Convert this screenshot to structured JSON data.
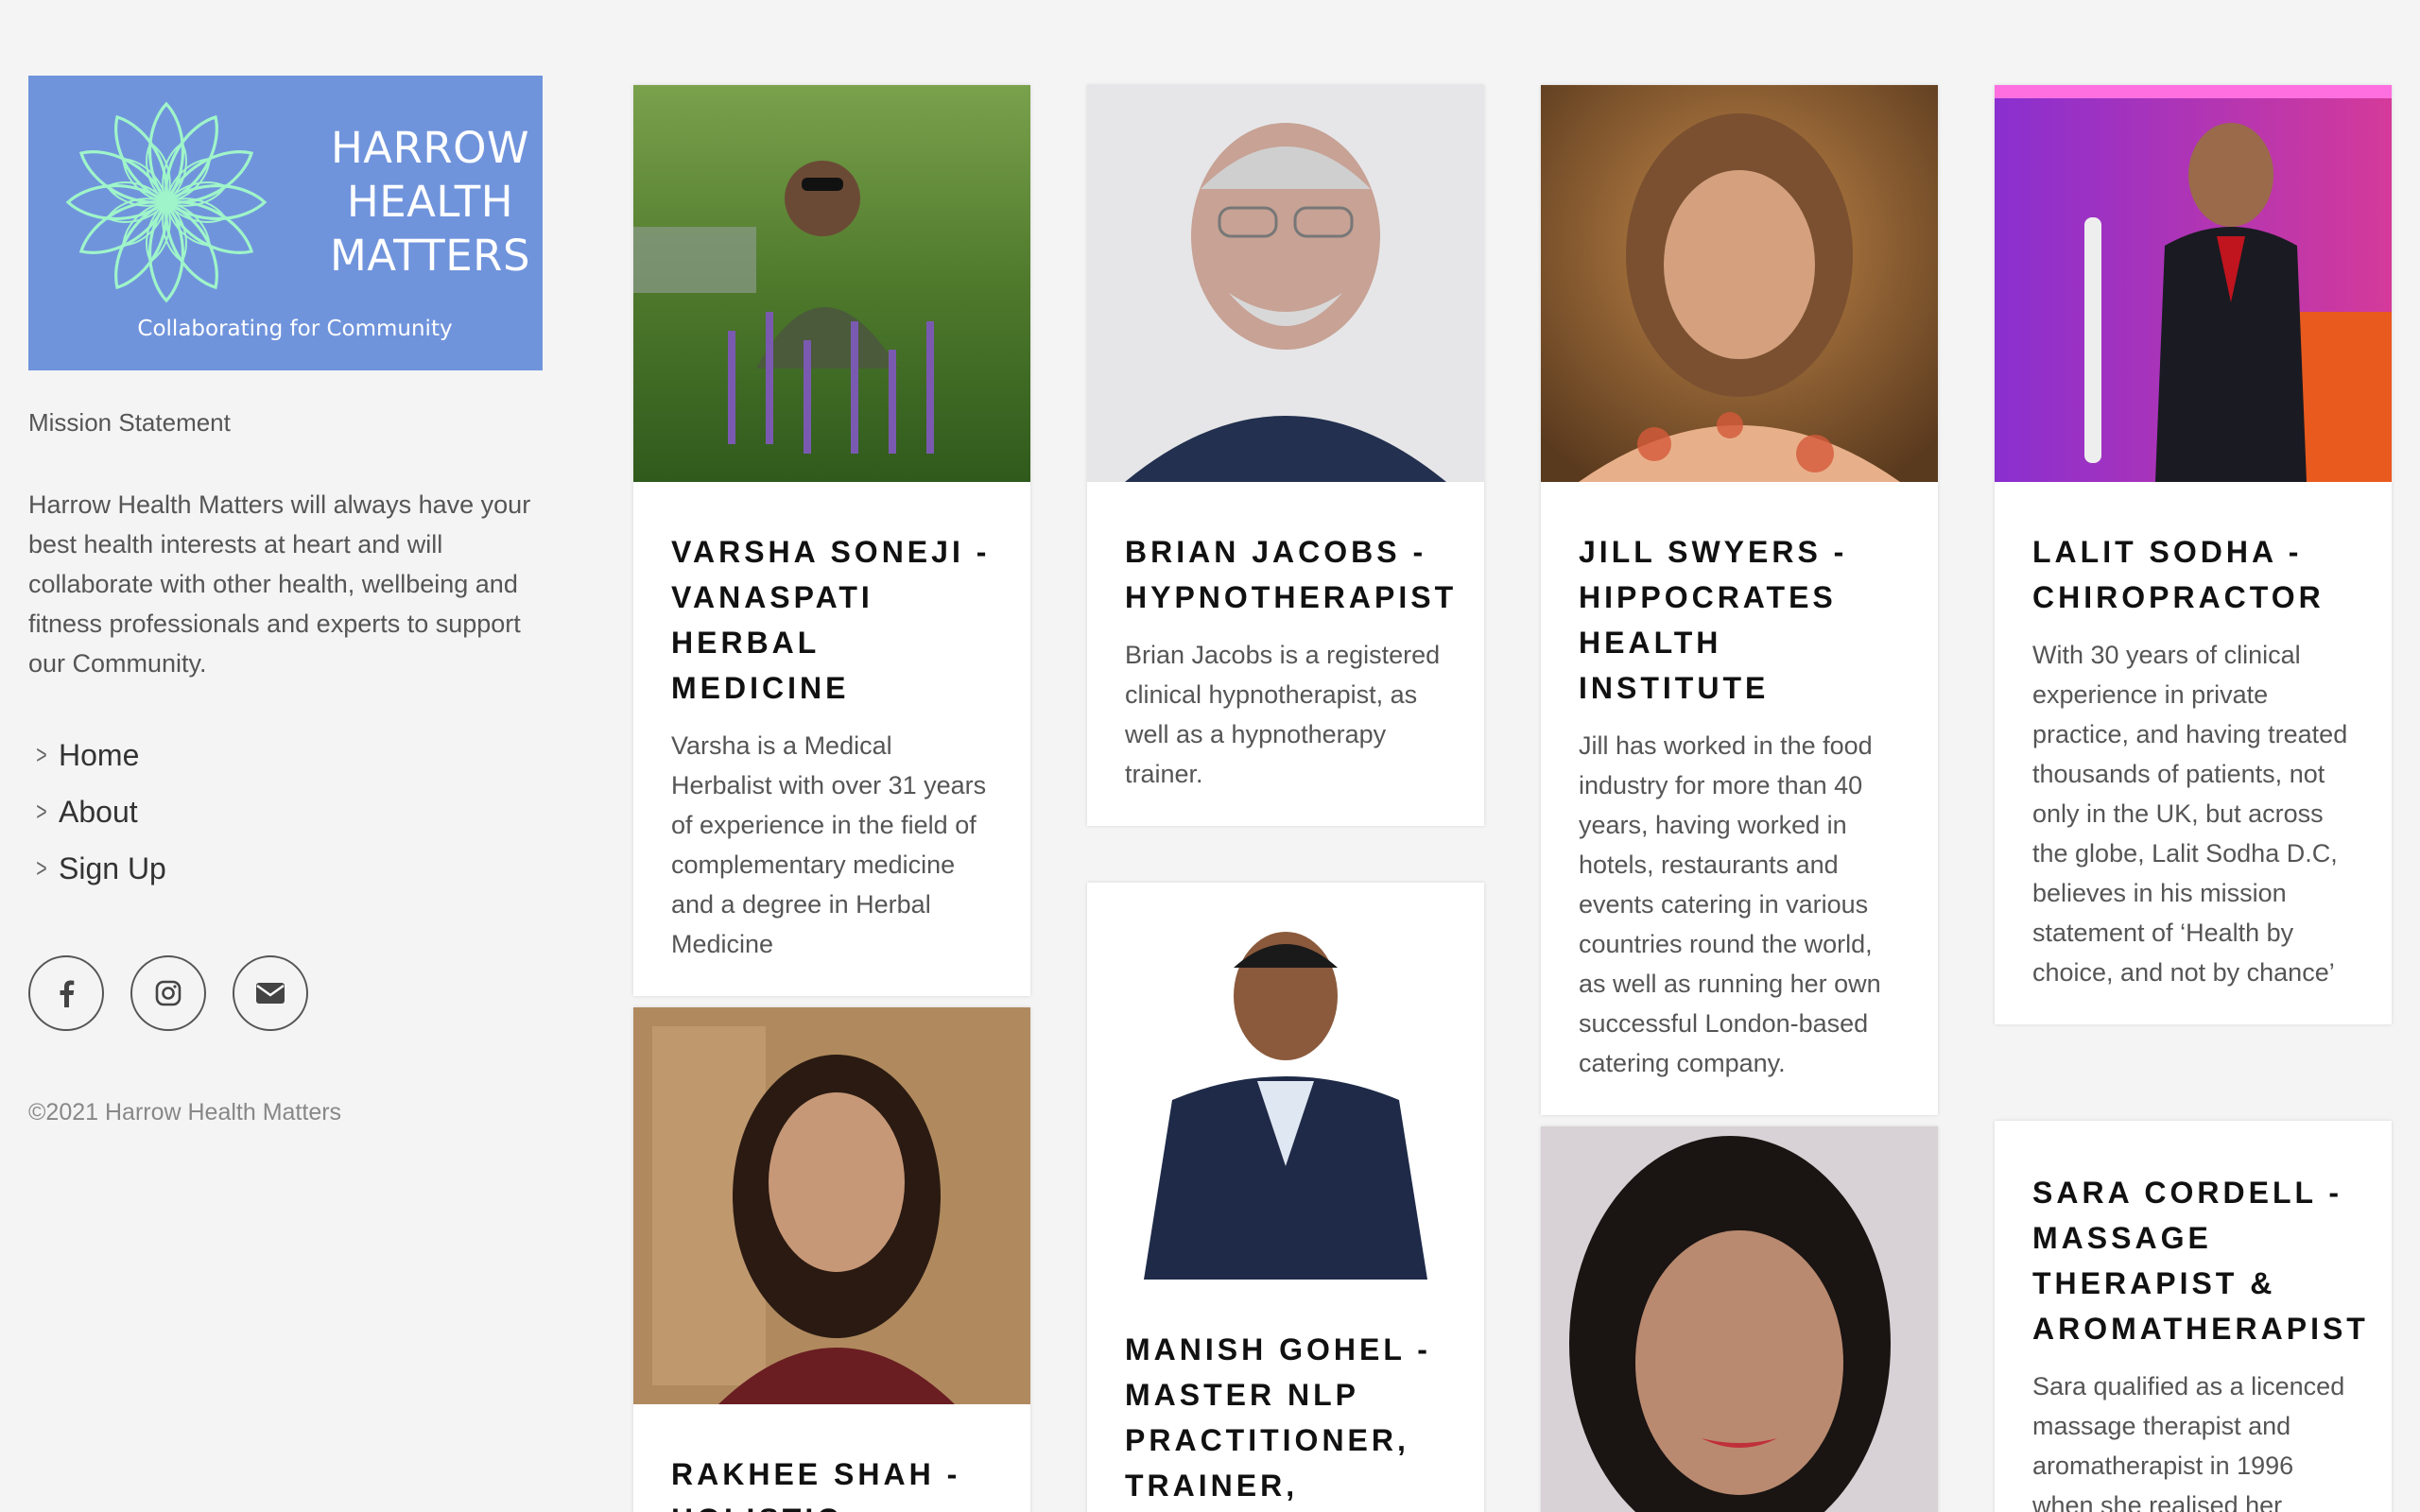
{
  "brand": {
    "line1": "HARROW",
    "line2": "HEALTH",
    "line3": "MATTERS",
    "tagline": "Collaborating for Community",
    "logo_bg": "#7094dc",
    "flower_color": "#9ff5c9"
  },
  "mission": {
    "title": "Mission Statement",
    "text": "Harrow Health Matters will always have your best health interests at heart and will collaborate with other health, wellbeing and fitness professionals and experts to support our Community."
  },
  "nav": [
    {
      "label": "Home"
    },
    {
      "label": "About"
    },
    {
      "label": "Sign Up"
    }
  ],
  "social": [
    {
      "icon": "facebook-icon"
    },
    {
      "icon": "instagram-icon"
    },
    {
      "icon": "envelope-icon"
    }
  ],
  "footer": {
    "copyright": "©2021 Harrow Health Matters"
  },
  "cards": [
    {
      "title": "VARSHA SONEJI - VANASPATI HERBAL MEDICINE",
      "text": "Varsha is a Medical Herbalist with over 31 years of experience in the field of complementary medicine and a degree in Herbal Medicine"
    },
    {
      "title": "BRIAN JACOBS - HYPNOTHERAPIST",
      "text": "Brian Jacobs is a registered clinical hypnotherapist, as well as a hypnotherapy trainer."
    },
    {
      "title": "JILL SWYERS - HIPPOCRATES HEALTH INSTITUTE",
      "text": "Jill has worked in the food industry for more than 40 years, having worked in hotels, restaurants and events catering in various countries round the world, as well as running her own successful London-based catering company."
    },
    {
      "title": "LALIT SODHA - CHIROPRACTOR",
      "text": "With 30 years of clinical experience in private practice, and having treated thousands of patients, not only in the UK, but across the globe, Lalit Sodha D.C, believes in his mission statement of ‘Health by choice, and not by chance’"
    },
    {
      "title": "RAKHEE SHAH - HOLISTIC",
      "text": ""
    },
    {
      "title": "MANISH GOHEL - MASTER NLP PRACTITIONER, TRAINER, COACH,",
      "text": ""
    },
    {
      "title": "",
      "text": ""
    },
    {
      "title": "SARA CORDELL - MASSAGE THERAPIST & AROMATHERAPIST",
      "text": "Sara qualified as a licenced massage therapist and aromatherapist in 1996 when she realised her"
    }
  ]
}
